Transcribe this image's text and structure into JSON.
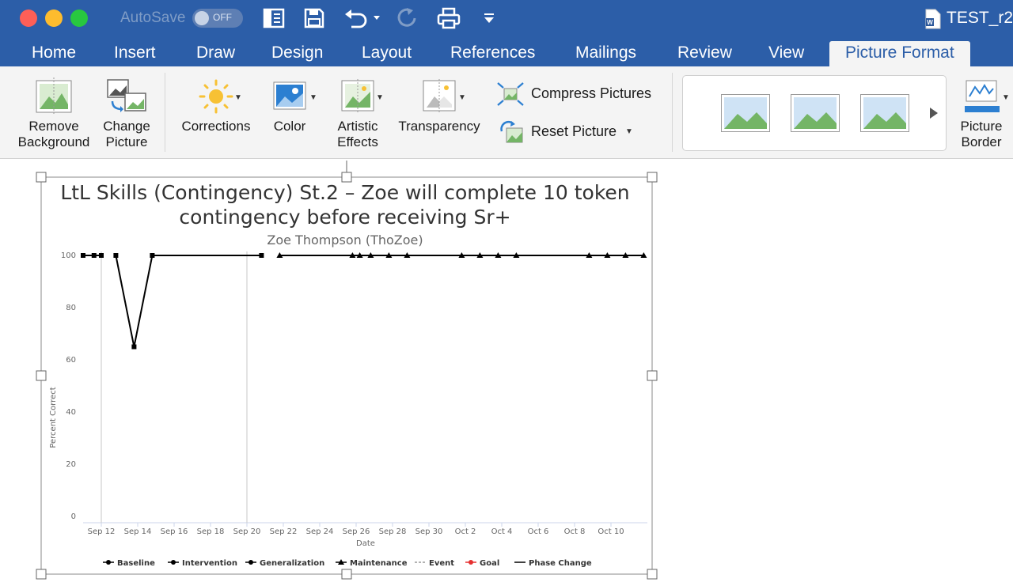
{
  "window": {
    "autosave_label": "AutoSave",
    "autosave_state": "OFF",
    "doc_title": "TEST_r2"
  },
  "tabs": [
    "Home",
    "Insert",
    "Draw",
    "Design",
    "Layout",
    "References",
    "Mailings",
    "Review",
    "View",
    "Picture Format"
  ],
  "active_tab": "Picture Format",
  "ribbon": {
    "remove_background": [
      "Remove",
      "Background"
    ],
    "change_picture": [
      "Change",
      "Picture"
    ],
    "corrections": "Corrections",
    "color": "Color",
    "artistic_effects": [
      "Artistic",
      "Effects"
    ],
    "transparency": "Transparency",
    "compress_pictures": "Compress Pictures",
    "reset_picture": "Reset Picture",
    "picture_border": [
      "Picture",
      "Border"
    ]
  },
  "icons": {
    "close": "close-dot",
    "minimize": "minimize-dot",
    "zoom": "zoom-dot",
    "sidebar": "sidebar-icon",
    "save": "save-icon",
    "undo": "undo-icon",
    "redo": "redo-icon",
    "print": "print-icon",
    "customize": "customize-toolbar-icon",
    "word_doc": "word-document-icon"
  },
  "colors": {
    "title_bar": "#2c5ea8",
    "ribbon": "#f4f4f4",
    "close": "#fd5f57",
    "minimize": "#febc2e",
    "zoom": "#28c840",
    "goal": "#e53030"
  },
  "chart_data": {
    "type": "line",
    "title": "LtL Skills (Contingency) St.2 – Zoe will complete 10 token contingency before receiving Sr+",
    "title_lines": [
      "LtL Skills (Contingency) St.2 – Zoe will complete 10 token",
      "contingency before receiving Sr+"
    ],
    "subtitle": "Zoe Thompson (ThoZoe)",
    "xlabel": "Date",
    "ylabel": "Percent Correct",
    "ylim": [
      0,
      100
    ],
    "yticks": [
      0,
      20,
      40,
      60,
      80,
      100
    ],
    "xlim": [
      "2018-09-11",
      "2018-10-12"
    ],
    "xticks": [
      "Sep 12",
      "Sep 14",
      "Sep 16",
      "Sep 18",
      "Sep 20",
      "Sep 22",
      "Sep 24",
      "Sep 26",
      "Sep 28",
      "Sep 30",
      "Oct 2",
      "Oct 4",
      "Oct 6",
      "Oct 8",
      "Oct 10"
    ],
    "grid": false,
    "legend_position": "bottom",
    "legend": [
      "Baseline",
      "Intervention",
      "Generalization",
      "Maintenance",
      "Event",
      "Goal",
      "Phase Change"
    ],
    "phase_changes": [
      "2018-09-12",
      "2018-09-20"
    ],
    "series": [
      {
        "name": "Intervention",
        "marker": "square",
        "segments": [
          [
            [
              "2018-09-11",
              100
            ],
            [
              "2018-09-11.6",
              100
            ],
            [
              "2018-09-12",
              100
            ]
          ],
          [
            [
              "2018-09-12.8",
              100
            ],
            [
              "2018-09-13.8",
              65
            ],
            [
              "2018-09-14.8",
              100
            ],
            [
              "2018-09-20.8",
              100
            ]
          ]
        ]
      },
      {
        "name": "Maintenance",
        "marker": "triangle",
        "segments": [
          [
            [
              "2018-09-21.8",
              100
            ],
            [
              "2018-09-25.8",
              100
            ],
            [
              "2018-09-26.2",
              100
            ],
            [
              "2018-09-26.8",
              100
            ],
            [
              "2018-09-27.8",
              100
            ],
            [
              "2018-09-28.8",
              100
            ],
            [
              "2018-10-01.8",
              100
            ],
            [
              "2018-10-02.8",
              100
            ],
            [
              "2018-10-03.8",
              100
            ],
            [
              "2018-10-04.8",
              100
            ],
            [
              "2018-10-08.8",
              100
            ],
            [
              "2018-10-09.8",
              100
            ],
            [
              "2018-10-10.8",
              100
            ],
            [
              "2018-10-11.8",
              100
            ]
          ]
        ]
      }
    ]
  }
}
